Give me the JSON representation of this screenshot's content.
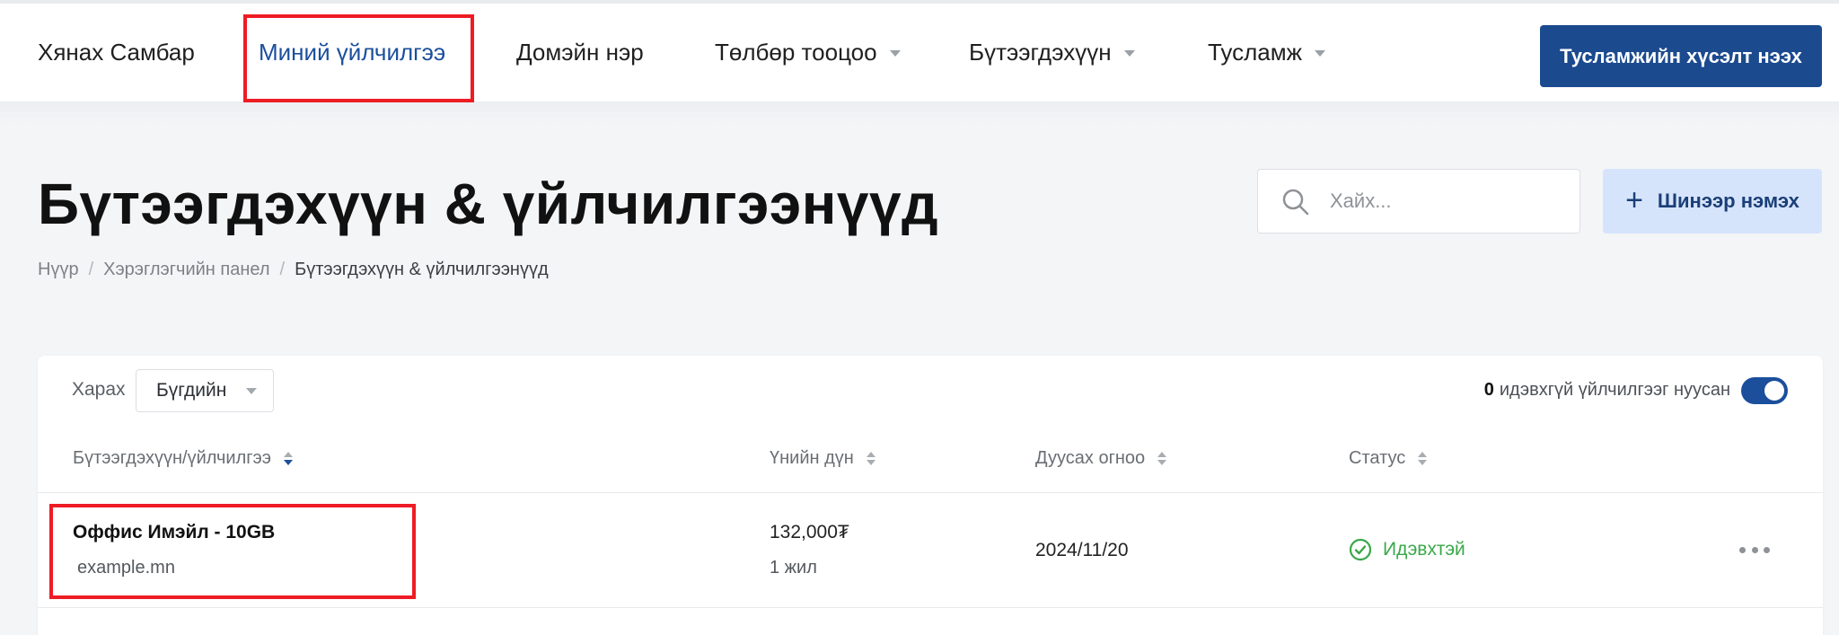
{
  "nav": {
    "items": [
      {
        "label": "Хянах Самбар"
      },
      {
        "label": "Миний үйлчилгээ"
      },
      {
        "label": "Домэйн нэр"
      },
      {
        "label": "Төлбөр тооцоо"
      },
      {
        "label": "Бүтээгдэхүүн"
      },
      {
        "label": "Тусламж"
      }
    ],
    "active_index": 1,
    "support_button": "Тусламжийн хүсэлт нээх"
  },
  "header": {
    "title": "Бүтээгдэхүүн & үйлчилгээнүүд",
    "breadcrumb": [
      "Нүүр",
      "Хэрэглэгчийн панел",
      "Бүтээгдэхүүн & үйлчилгээнүүд"
    ],
    "search_placeholder": "Хайх...",
    "add_button": "Шинээр нэмэх",
    "add_icon": "plus-icon"
  },
  "filter": {
    "view_label": "Харах",
    "view_value": "Бүгдийн",
    "inactive_count": "0",
    "inactive_text": "идэвхгүй үйлчилгээг нуусан",
    "toggle_on": true
  },
  "table": {
    "columns": [
      {
        "label": "Бүтээгдэхүүн/үйлчилгээ",
        "sorted": true
      },
      {
        "label": "Үнийн дүн",
        "sorted": false
      },
      {
        "label": "Дуусах огноо",
        "sorted": false
      },
      {
        "label": "Статус",
        "sorted": false
      }
    ],
    "rows": [
      {
        "name": "Оффис Имэйл - 10GB",
        "domain": "example.mn",
        "price": "132,000₮",
        "period": "1 жил",
        "due_date": "2024/11/20",
        "status": "Идэвхтэй",
        "status_color": "#3aa84a"
      }
    ]
  },
  "colors": {
    "accent": "#1b4f9c",
    "support_button_bg": "#1b4a8f",
    "add_button_bg": "#d6e4fb",
    "highlight": "#ee1c24",
    "status_active": "#3aa84a"
  }
}
